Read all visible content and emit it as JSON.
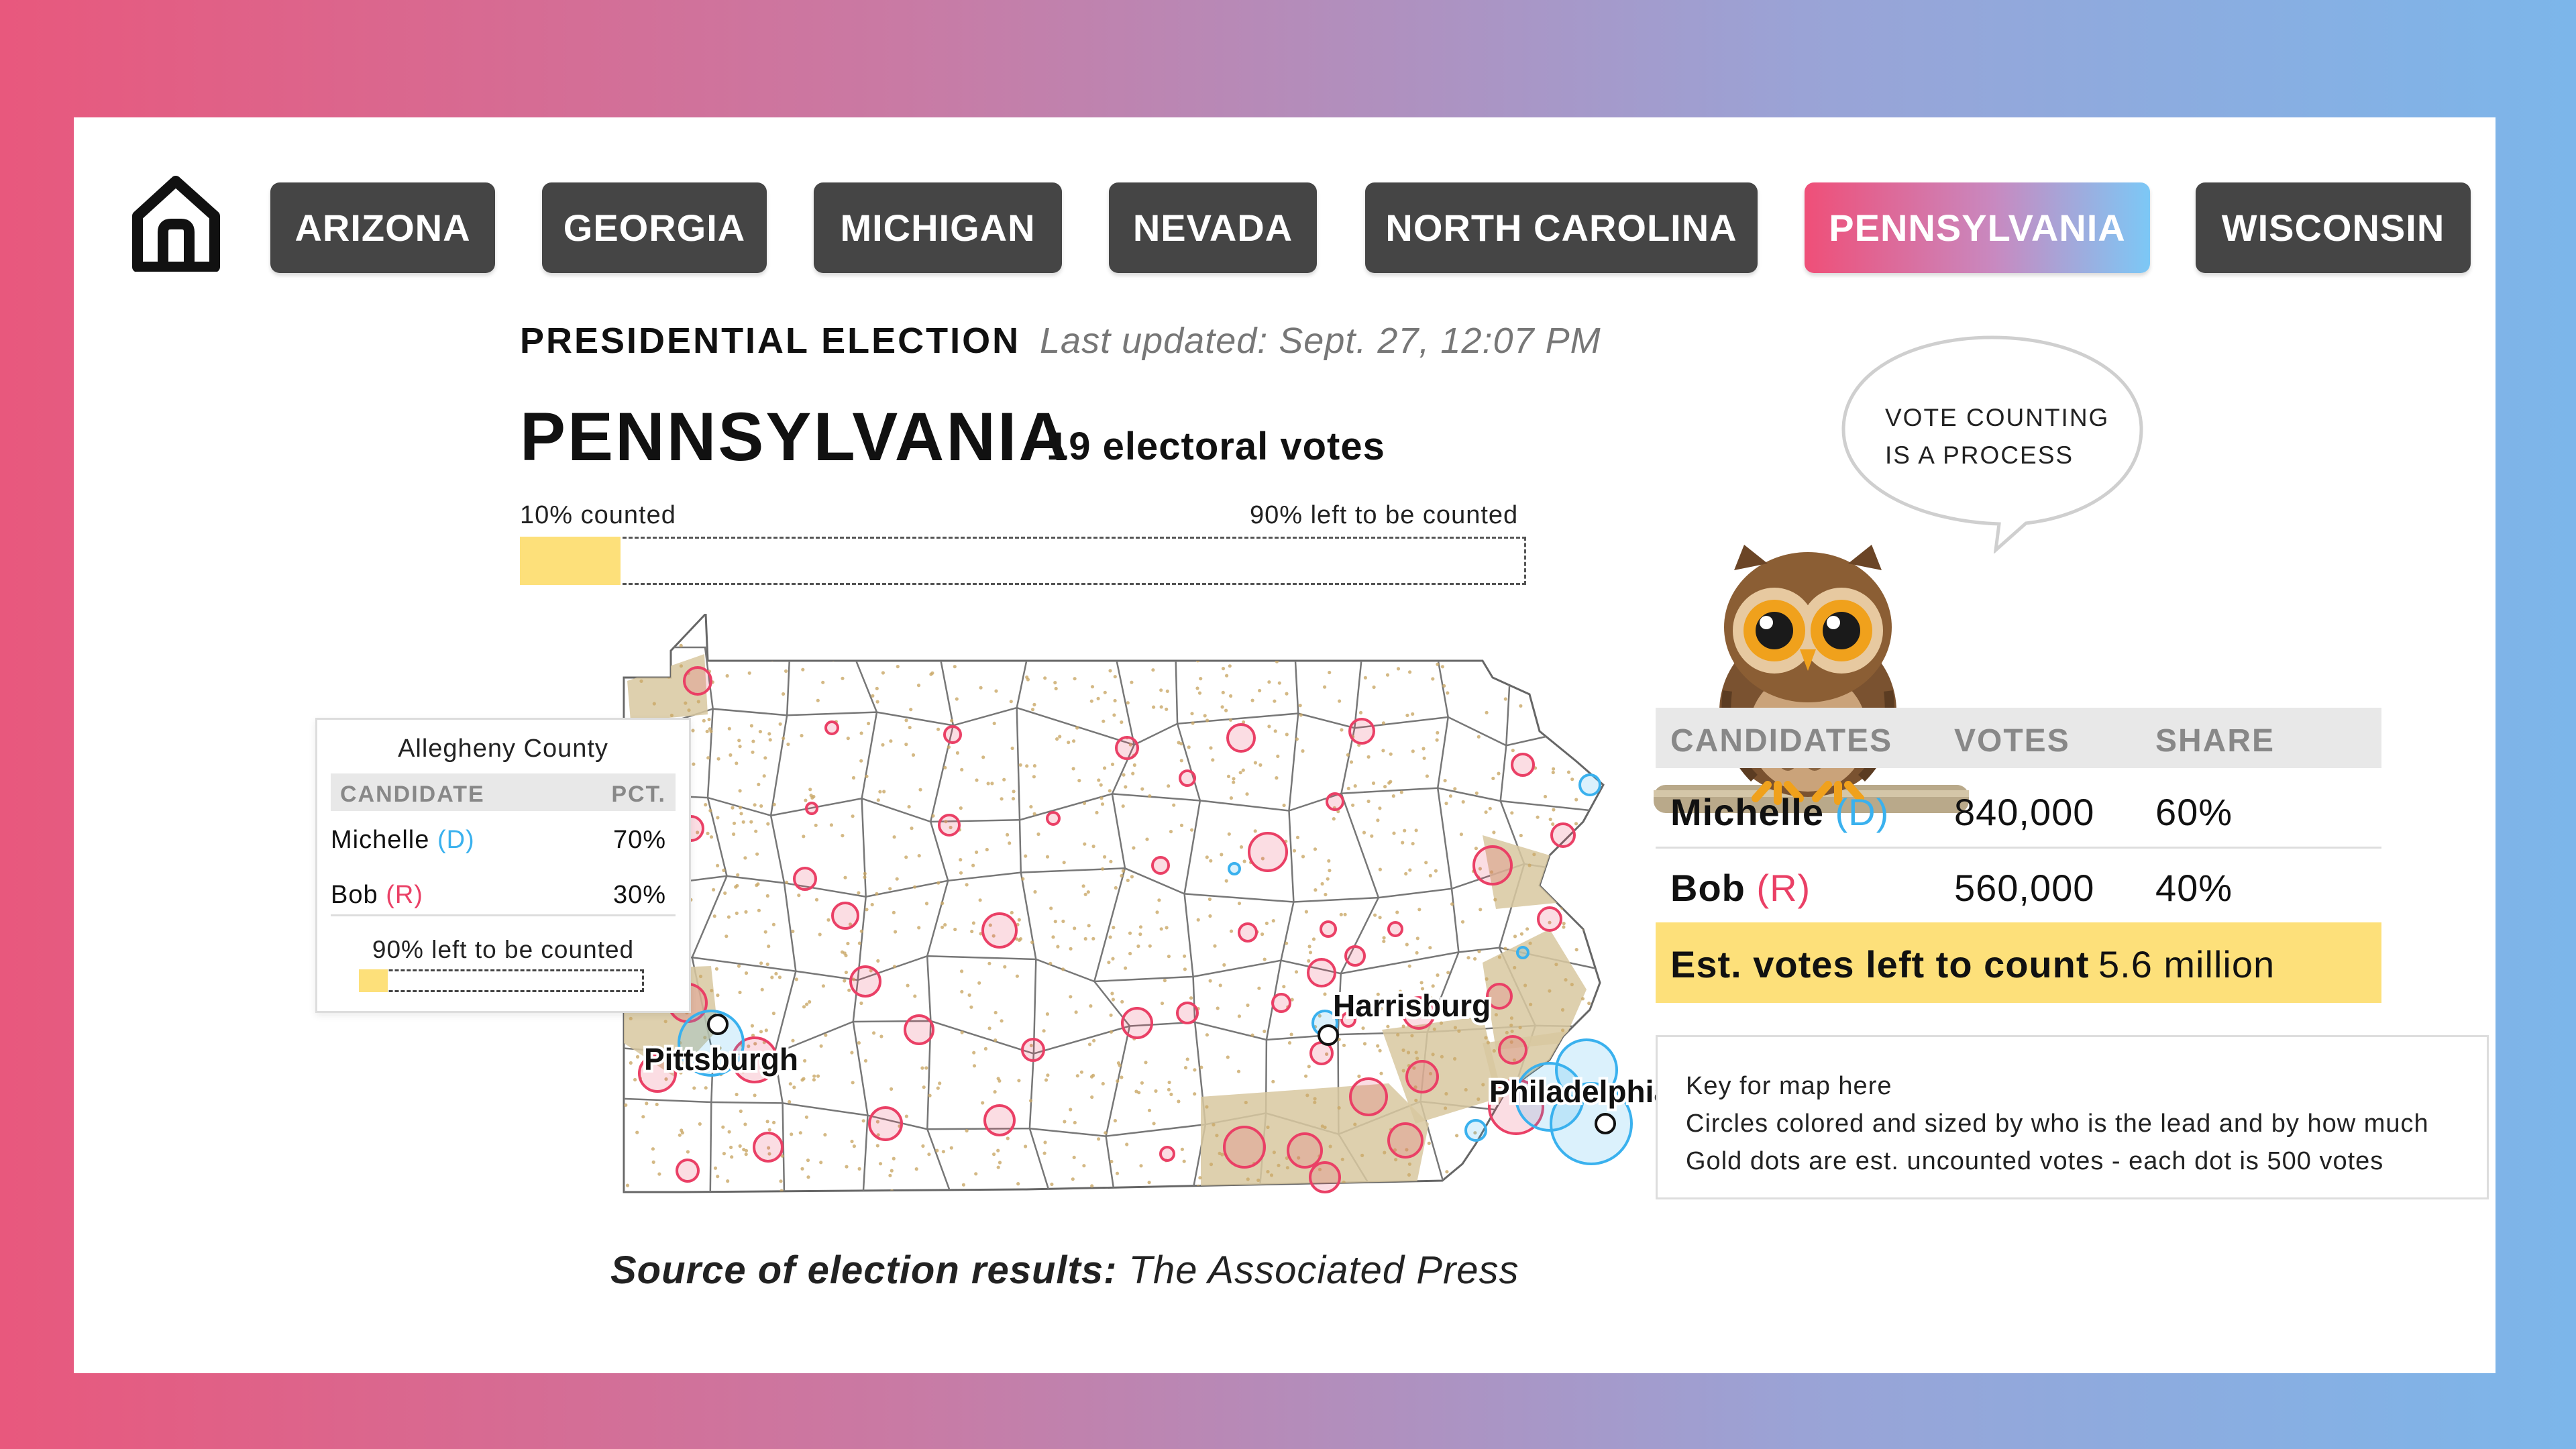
{
  "nav": {
    "home_icon": "home-icon",
    "tabs": [
      {
        "label": "ARIZONA",
        "active": false
      },
      {
        "label": "GEORGIA",
        "active": false
      },
      {
        "label": "MICHIGAN",
        "active": false
      },
      {
        "label": "NEVADA",
        "active": false
      },
      {
        "label": "NORTH CAROLINA",
        "active": false
      },
      {
        "label": "PENNSYLVANIA",
        "active": true
      },
      {
        "label": "WISCONSIN",
        "active": false
      }
    ]
  },
  "header": {
    "election_label": "PRESIDENTIAL ELECTION",
    "last_updated": "Last updated: Sept. 27, 12:07 PM",
    "state": "PENNSYLVANIA",
    "electoral_votes": "19 electoral votes"
  },
  "progress": {
    "counted_label": "10% counted",
    "left_label": "90% left to be counted",
    "counted_fraction": 0.1
  },
  "map": {
    "cities": {
      "pittsburgh": "Pittsburgh",
      "harrisburg": "Harrisburg",
      "philadelphia": "Philadelphia"
    }
  },
  "county_popup": {
    "title": "Allegheny County",
    "col_candidate": "CANDIDATE",
    "col_pct": "PCT.",
    "rows": [
      {
        "name": "Michelle",
        "party": "(D)",
        "pct": "70%"
      },
      {
        "name": "Bob",
        "party": "(R)",
        "pct": "30%"
      }
    ],
    "left_label": "90% left to be counted",
    "counted_fraction": 0.1
  },
  "owl_bubble": {
    "line1": "VOTE COUNTING",
    "line2": "IS A PROCESS"
  },
  "results": {
    "col_candidates": "CANDIDATES",
    "col_votes": "VOTES",
    "col_share": "SHARE",
    "rows": [
      {
        "name": "Michelle",
        "party": "(D)",
        "votes": "840,000",
        "share": "60%"
      },
      {
        "name": "Bob",
        "party": "(R)",
        "votes": "560,000",
        "share": "40%"
      }
    ],
    "est_label": "Est. votes left to count",
    "est_value": "5.6 million"
  },
  "key": {
    "title": "Key for map here",
    "line1": "Circles colored and sized by who is the lead and by how much",
    "line2": "Gold dots are est. uncounted votes - each dot is 500 votes"
  },
  "source": {
    "label": "Source of election results:",
    "value": "The Associated Press"
  },
  "colors": {
    "dem": "#3ab1ee",
    "rep": "#ea4066",
    "gold": "#fde07a",
    "tab": "#454545"
  }
}
